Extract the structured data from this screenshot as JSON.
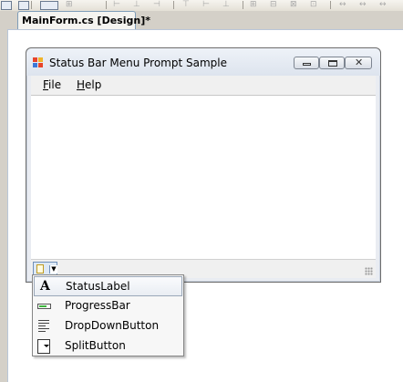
{
  "document_tab": {
    "label": "MainForm.cs [Design]*"
  },
  "form": {
    "title": "Status Bar Menu Prompt Sample",
    "menu": [
      {
        "label": "File",
        "mnemonic": "F",
        "rest": "ile"
      },
      {
        "label": "Help",
        "mnemonic": "H",
        "rest": "elp"
      }
    ]
  },
  "status_dropdown": {
    "items": [
      {
        "label": "StatusLabel",
        "icon": "status-label-icon",
        "selected": true
      },
      {
        "label": "ProgressBar",
        "icon": "progress-bar-icon",
        "selected": false
      },
      {
        "label": "DropDownButton",
        "icon": "dropdown-button-icon",
        "selected": false
      },
      {
        "label": "SplitButton",
        "icon": "split-button-icon",
        "selected": false
      }
    ]
  },
  "colors": {
    "selection_border": "#9aa7b8",
    "progress_fill": "#3db43d",
    "designer_background": "#ffffff"
  }
}
